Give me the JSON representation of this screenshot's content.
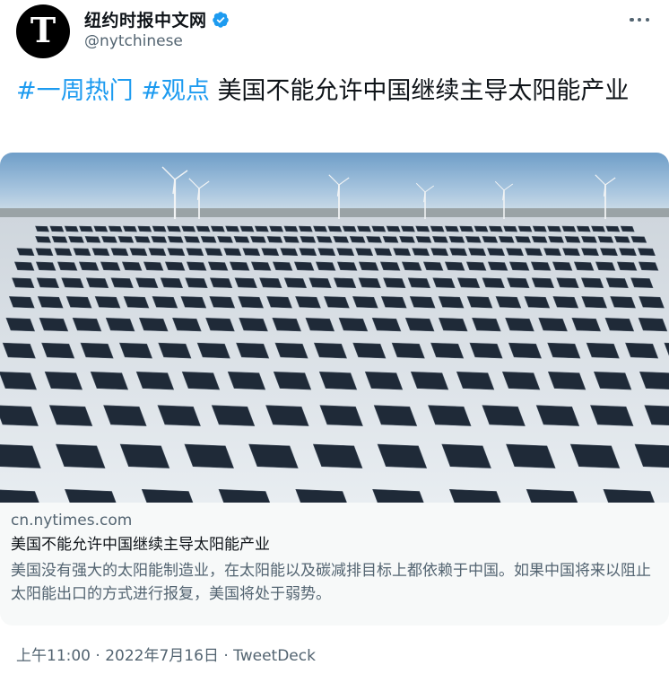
{
  "header": {
    "display_name": "纽约时报中文网",
    "handle": "@nytchinese",
    "avatar_letter": "T",
    "verified": true
  },
  "tweet": {
    "hashtags": [
      "#一周热门",
      "#观点"
    ],
    "text": "美国不能允许中国继续主导太阳能产业"
  },
  "card": {
    "image": "solar-farm-photo",
    "domain": "cn.nytimes.com",
    "title": "美国不能允许中国继续主导太阳能产业",
    "description": "美国没有强大的太阳能制造业，在太阳能以及碳减排目标上都依赖于中国。如果中国将来以阻止太阳能出口的方式进行报复，美国将处于弱势。"
  },
  "footer": {
    "time": "上午11:00",
    "separator": " · ",
    "date": "2022年7月16日",
    "source": "TweetDeck"
  },
  "colors": {
    "accent": "#1d9bf0",
    "text_primary": "#0f1419",
    "text_secondary": "#536471",
    "card_bg": "#f7f9f9"
  },
  "icons": [
    "verified-badge-icon",
    "more-options-icon"
  ]
}
